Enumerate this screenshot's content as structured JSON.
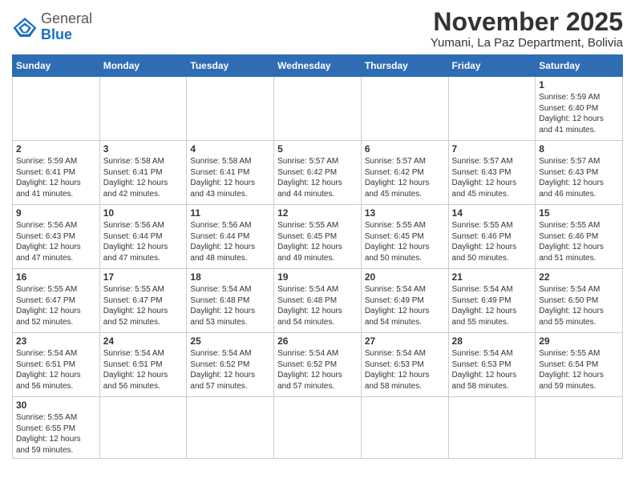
{
  "header": {
    "title": "November 2025",
    "location": "Yumani, La Paz Department, Bolivia",
    "logo_general": "General",
    "logo_blue": "Blue"
  },
  "days_of_week": [
    "Sunday",
    "Monday",
    "Tuesday",
    "Wednesday",
    "Thursday",
    "Friday",
    "Saturday"
  ],
  "weeks": [
    [
      {
        "day": "",
        "info": ""
      },
      {
        "day": "",
        "info": ""
      },
      {
        "day": "",
        "info": ""
      },
      {
        "day": "",
        "info": ""
      },
      {
        "day": "",
        "info": ""
      },
      {
        "day": "",
        "info": ""
      },
      {
        "day": "1",
        "info": "Sunrise: 5:59 AM\nSunset: 6:40 PM\nDaylight: 12 hours\nand 41 minutes."
      }
    ],
    [
      {
        "day": "2",
        "info": "Sunrise: 5:59 AM\nSunset: 6:41 PM\nDaylight: 12 hours\nand 41 minutes."
      },
      {
        "day": "3",
        "info": "Sunrise: 5:58 AM\nSunset: 6:41 PM\nDaylight: 12 hours\nand 42 minutes."
      },
      {
        "day": "4",
        "info": "Sunrise: 5:58 AM\nSunset: 6:41 PM\nDaylight: 12 hours\nand 43 minutes."
      },
      {
        "day": "5",
        "info": "Sunrise: 5:57 AM\nSunset: 6:42 PM\nDaylight: 12 hours\nand 44 minutes."
      },
      {
        "day": "6",
        "info": "Sunrise: 5:57 AM\nSunset: 6:42 PM\nDaylight: 12 hours\nand 45 minutes."
      },
      {
        "day": "7",
        "info": "Sunrise: 5:57 AM\nSunset: 6:43 PM\nDaylight: 12 hours\nand 45 minutes."
      },
      {
        "day": "8",
        "info": "Sunrise: 5:57 AM\nSunset: 6:43 PM\nDaylight: 12 hours\nand 46 minutes."
      }
    ],
    [
      {
        "day": "9",
        "info": "Sunrise: 5:56 AM\nSunset: 6:43 PM\nDaylight: 12 hours\nand 47 minutes."
      },
      {
        "day": "10",
        "info": "Sunrise: 5:56 AM\nSunset: 6:44 PM\nDaylight: 12 hours\nand 47 minutes."
      },
      {
        "day": "11",
        "info": "Sunrise: 5:56 AM\nSunset: 6:44 PM\nDaylight: 12 hours\nand 48 minutes."
      },
      {
        "day": "12",
        "info": "Sunrise: 5:55 AM\nSunset: 6:45 PM\nDaylight: 12 hours\nand 49 minutes."
      },
      {
        "day": "13",
        "info": "Sunrise: 5:55 AM\nSunset: 6:45 PM\nDaylight: 12 hours\nand 50 minutes."
      },
      {
        "day": "14",
        "info": "Sunrise: 5:55 AM\nSunset: 6:46 PM\nDaylight: 12 hours\nand 50 minutes."
      },
      {
        "day": "15",
        "info": "Sunrise: 5:55 AM\nSunset: 6:46 PM\nDaylight: 12 hours\nand 51 minutes."
      }
    ],
    [
      {
        "day": "16",
        "info": "Sunrise: 5:55 AM\nSunset: 6:47 PM\nDaylight: 12 hours\nand 52 minutes."
      },
      {
        "day": "17",
        "info": "Sunrise: 5:55 AM\nSunset: 6:47 PM\nDaylight: 12 hours\nand 52 minutes."
      },
      {
        "day": "18",
        "info": "Sunrise: 5:54 AM\nSunset: 6:48 PM\nDaylight: 12 hours\nand 53 minutes."
      },
      {
        "day": "19",
        "info": "Sunrise: 5:54 AM\nSunset: 6:48 PM\nDaylight: 12 hours\nand 54 minutes."
      },
      {
        "day": "20",
        "info": "Sunrise: 5:54 AM\nSunset: 6:49 PM\nDaylight: 12 hours\nand 54 minutes."
      },
      {
        "day": "21",
        "info": "Sunrise: 5:54 AM\nSunset: 6:49 PM\nDaylight: 12 hours\nand 55 minutes."
      },
      {
        "day": "22",
        "info": "Sunrise: 5:54 AM\nSunset: 6:50 PM\nDaylight: 12 hours\nand 55 minutes."
      }
    ],
    [
      {
        "day": "23",
        "info": "Sunrise: 5:54 AM\nSunset: 6:51 PM\nDaylight: 12 hours\nand 56 minutes."
      },
      {
        "day": "24",
        "info": "Sunrise: 5:54 AM\nSunset: 6:51 PM\nDaylight: 12 hours\nand 56 minutes."
      },
      {
        "day": "25",
        "info": "Sunrise: 5:54 AM\nSunset: 6:52 PM\nDaylight: 12 hours\nand 57 minutes."
      },
      {
        "day": "26",
        "info": "Sunrise: 5:54 AM\nSunset: 6:52 PM\nDaylight: 12 hours\nand 57 minutes."
      },
      {
        "day": "27",
        "info": "Sunrise: 5:54 AM\nSunset: 6:53 PM\nDaylight: 12 hours\nand 58 minutes."
      },
      {
        "day": "28",
        "info": "Sunrise: 5:54 AM\nSunset: 6:53 PM\nDaylight: 12 hours\nand 58 minutes."
      },
      {
        "day": "29",
        "info": "Sunrise: 5:55 AM\nSunset: 6:54 PM\nDaylight: 12 hours\nand 59 minutes."
      }
    ],
    [
      {
        "day": "30",
        "info": "Sunrise: 5:55 AM\nSunset: 6:55 PM\nDaylight: 12 hours\nand 59 minutes."
      },
      {
        "day": "",
        "info": ""
      },
      {
        "day": "",
        "info": ""
      },
      {
        "day": "",
        "info": ""
      },
      {
        "day": "",
        "info": ""
      },
      {
        "day": "",
        "info": ""
      },
      {
        "day": "",
        "info": ""
      }
    ]
  ]
}
